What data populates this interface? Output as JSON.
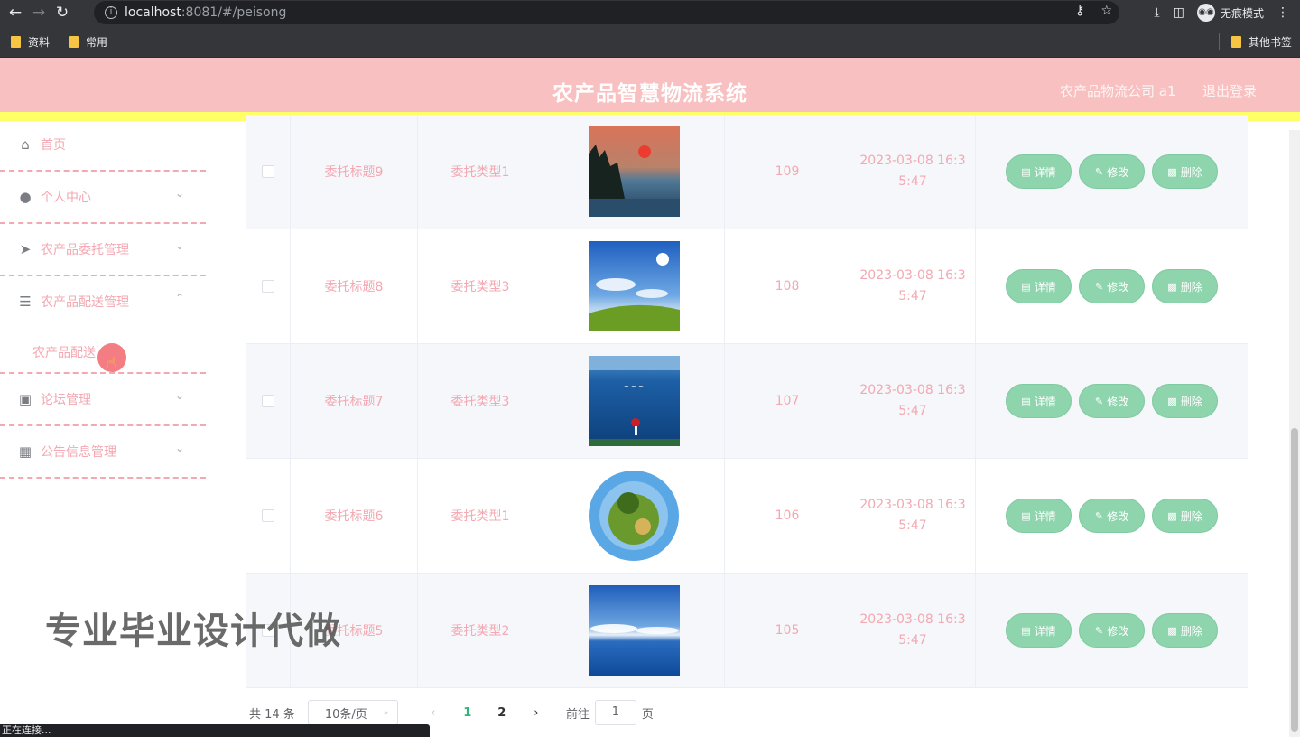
{
  "browser": {
    "url_host": "localhost",
    "url_rest": ":8081/#/peisong",
    "incognito_label": "无痕模式",
    "bookmarks": [
      "资料",
      "常用"
    ],
    "other_bookmarks": "其他书签",
    "status_text": "正在连接..."
  },
  "header": {
    "title": "农产品智慧物流系统",
    "user": "农产品物流公司 a1",
    "logout": "退出登录"
  },
  "sidebar": {
    "items": [
      {
        "label": "首页",
        "icon": "home-icon"
      },
      {
        "label": "个人中心",
        "icon": "user-icon"
      },
      {
        "label": "农产品委托管理",
        "icon": "send-icon"
      },
      {
        "label": "农产品配送管理",
        "icon": "sliders-icon"
      },
      {
        "label": "论坛管理",
        "icon": "briefcase-icon"
      },
      {
        "label": "公告信息管理",
        "icon": "grid-icon"
      }
    ],
    "submenu_label": "农产品配送"
  },
  "table": {
    "rows": [
      {
        "title": "委托标题9",
        "type": "委托类型1",
        "num": "109",
        "date": "2023-03-08 16:35:47",
        "image": "sunset-lake"
      },
      {
        "title": "委托标题8",
        "type": "委托类型3",
        "num": "108",
        "date": "2023-03-08 16:35:47",
        "image": "sky-meadow"
      },
      {
        "title": "委托标题7",
        "type": "委托类型3",
        "num": "107",
        "date": "2023-03-08 16:35:47",
        "image": "blue-sea-person"
      },
      {
        "title": "委托标题6",
        "type": "委托类型1",
        "num": "106",
        "date": "2023-03-08 16:35:47",
        "image": "tiny-planet"
      },
      {
        "title": "委托标题5",
        "type": "委托类型2",
        "num": "105",
        "date": "2023-03-08 16:35:47",
        "image": "clouds-ocean"
      }
    ],
    "btn_detail": "详情",
    "btn_edit": "修改",
    "btn_delete": "删除"
  },
  "pagination": {
    "total": "共 14 条",
    "page_size": "10条/页",
    "pages": [
      "1",
      "2"
    ],
    "goto_prefix": "前往",
    "goto_value": "1",
    "goto_suffix": "页"
  },
  "watermark": "专业毕业设计代做",
  "colors": {
    "header_bg": "#f8c0c0",
    "accent_pink": "#f3a8b2",
    "button_green": "#8ed4ad",
    "header_border": "#ffff66"
  }
}
